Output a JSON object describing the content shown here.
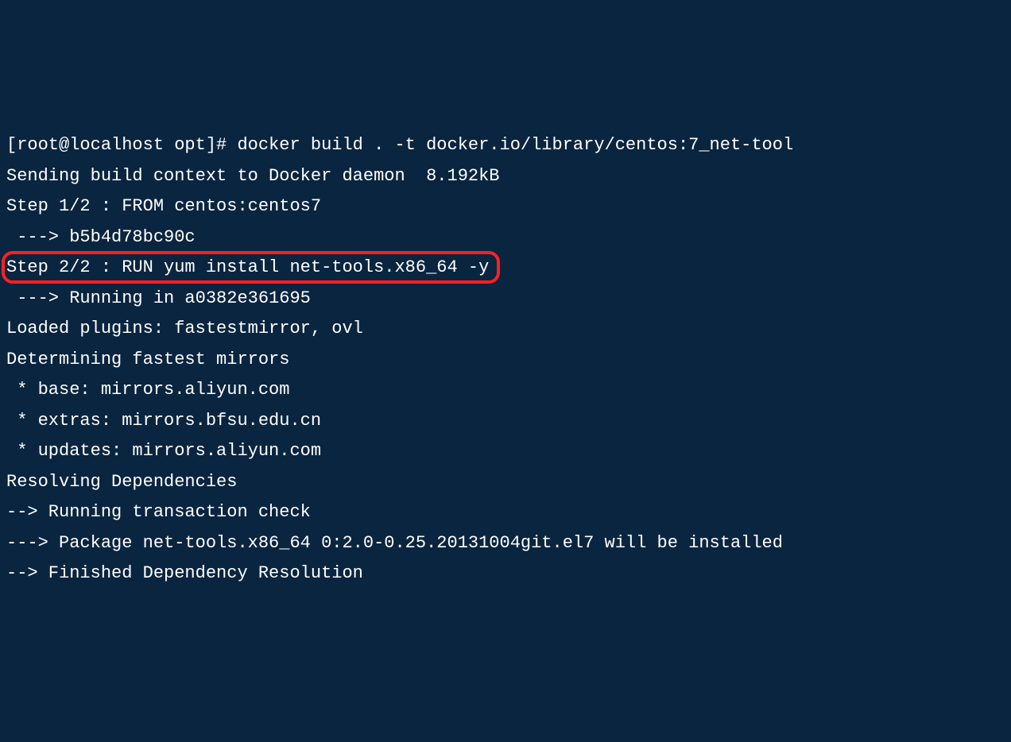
{
  "terminal": {
    "lines": {
      "l0": "[root@localhost opt]# docker build . -t docker.io/library/centos:7_net-tool",
      "l1": "Sending build context to Docker daemon  8.192kB",
      "l2": "Step 1/2 : FROM centos:centos7",
      "l3": " ---> b5b4d78bc90c",
      "l4": "Step 2/2 : RUN yum install net-tools.x86_64 -y",
      "l5": " ---> Running in a0382e361695",
      "l6": "Loaded plugins: fastestmirror, ovl",
      "l7": "Determining fastest mirrors",
      "l8": " * base: mirrors.aliyun.com",
      "l9": " * extras: mirrors.bfsu.edu.cn",
      "l10": " * updates: mirrors.aliyun.com",
      "l11": "Resolving Dependencies",
      "l12": "--> Running transaction check",
      "l13": "---> Package net-tools.x86_64 0:2.0-0.25.20131004git.el7 will be installed",
      "l14": "--> Finished Dependency Resolution"
    }
  }
}
